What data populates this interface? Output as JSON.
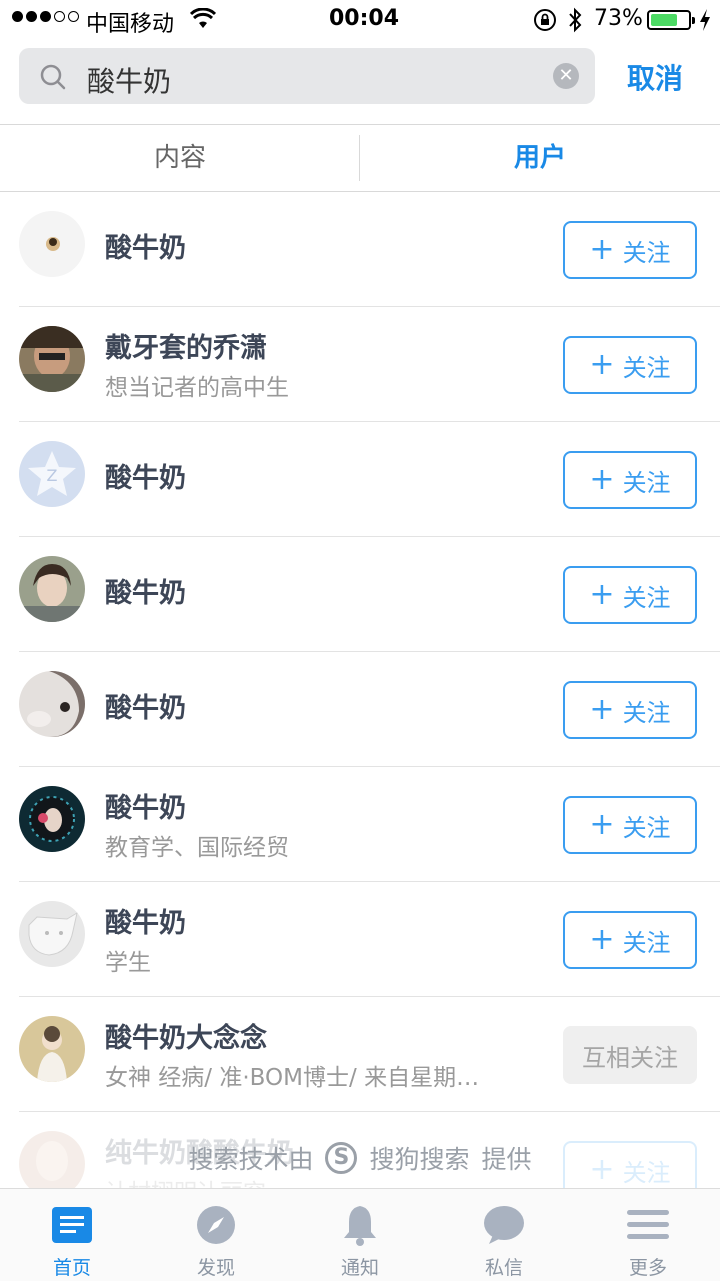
{
  "status_bar": {
    "carrier": "中国移动",
    "time": "00:04",
    "battery_percent": "73%",
    "battery_level": 0.73
  },
  "search": {
    "query": "酸牛奶",
    "cancel_label": "取消"
  },
  "tabs": [
    {
      "label": "内容",
      "active": false
    },
    {
      "label": "用户",
      "active": true
    }
  ],
  "users": [
    {
      "name": "酸牛奶",
      "desc": "",
      "action": "+ 关注"
    },
    {
      "name": "戴牙套的乔潇",
      "desc": "想当记者的高中生",
      "action": "+ 关注"
    },
    {
      "name": "酸牛奶",
      "desc": "",
      "action": "+ 关注"
    },
    {
      "name": "酸牛奶",
      "desc": "",
      "action": "+ 关注"
    },
    {
      "name": "酸牛奶",
      "desc": "",
      "action": "+ 关注"
    },
    {
      "name": "酸牛奶",
      "desc": "教育学、国际经贸",
      "action": "+ 关注"
    },
    {
      "name": "酸牛奶",
      "desc": "学生",
      "action": "+ 关注"
    },
    {
      "name": "酸牛奶大念念",
      "desc": "女神 经病/ 准·BOM博士/ 来自星期…",
      "action": "互相关注"
    },
    {
      "name": "纯牛奶酸酸牛奶",
      "desc": "计村栩明讣丽究",
      "action": "+ 关注"
    }
  ],
  "follow_text": "关注",
  "watermark": {
    "prefix": "搜索技术由",
    "brand": "搜狗搜索",
    "suffix": "提供"
  },
  "tabbar": [
    {
      "label": "首页",
      "icon": "home-list-icon",
      "active": true
    },
    {
      "label": "发现",
      "icon": "compass-icon",
      "active": false
    },
    {
      "label": "通知",
      "icon": "bell-icon",
      "active": false
    },
    {
      "label": "私信",
      "icon": "chat-bubble-icon",
      "active": false
    },
    {
      "label": "更多",
      "icon": "menu-lines-icon",
      "active": false
    }
  ],
  "colors": {
    "accent": "#1989e6",
    "follow_border": "#3a9df0",
    "tab_inactive": "#8c96a3"
  }
}
